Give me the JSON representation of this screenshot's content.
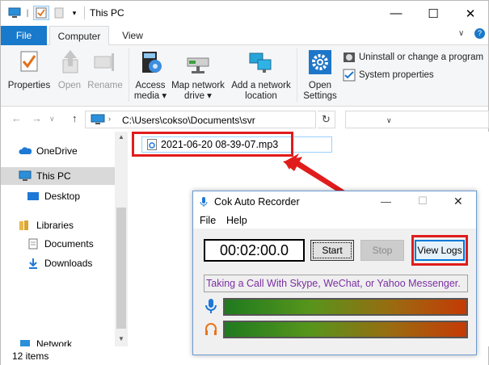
{
  "window": {
    "title": "This PC"
  },
  "ribbon_tabs": {
    "file": "File",
    "computer": "Computer",
    "view": "View"
  },
  "ribbon": {
    "properties": "Properties",
    "open": "Open",
    "rename": "Rename",
    "access_media_l1": "Access",
    "access_media_l2": "media ▾",
    "map_drive_l1": "Map network",
    "map_drive_l2": "drive ▾",
    "add_location_l1": "Add a network",
    "add_location_l2": "location",
    "open_settings_l1": "Open",
    "open_settings_l2": "Settings",
    "uninstall": "Uninstall or change a program",
    "system_properties": "System properties"
  },
  "address": {
    "path": "C:\\Users\\cokso\\Documents\\svr"
  },
  "nav_pane": {
    "items": [
      {
        "label": "OneDrive",
        "icon": "cloud-icon"
      },
      {
        "label": "This PC",
        "icon": "computer-icon"
      },
      {
        "label": "Desktop",
        "icon": "desktop-icon"
      },
      {
        "label": "Libraries",
        "icon": "libraries-icon"
      },
      {
        "label": "Documents",
        "icon": "documents-icon"
      },
      {
        "label": "Downloads",
        "icon": "downloads-icon"
      },
      {
        "label": "Network",
        "icon": "network-icon"
      }
    ]
  },
  "file_list": {
    "items": [
      {
        "name": "2021-06-20 08-39-07.mp3",
        "icon": "audio-file-icon"
      }
    ]
  },
  "status_bar": {
    "count": "12 items"
  },
  "recorder": {
    "title": "Cok Auto Recorder",
    "menu_file": "File",
    "menu_help": "Help",
    "timer": "00:02:00.0",
    "start": "Start",
    "stop": "Stop",
    "view_logs": "View Logs",
    "status": "Taking a Call With Skype, WeChat, or Yahoo Messenger."
  },
  "colors": {
    "accent": "#1979ca",
    "highlight_red": "#e11c1c",
    "status_text": "#7b2fa3",
    "selection": "#d9d9d9"
  }
}
